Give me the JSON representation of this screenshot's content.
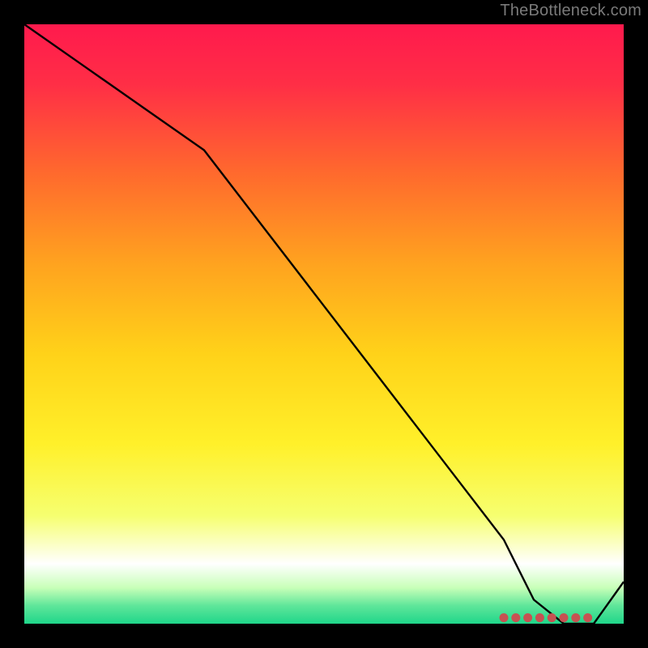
{
  "watermark": "TheBottleneck.com",
  "chart_data": {
    "type": "line",
    "title": "",
    "xlabel": "",
    "ylabel": "",
    "xlim": [
      0,
      100
    ],
    "ylim": [
      0,
      100
    ],
    "x": [
      0,
      10,
      20,
      30,
      40,
      50,
      60,
      70,
      80,
      85,
      90,
      95,
      100
    ],
    "values": [
      100,
      93,
      86,
      79,
      66,
      53,
      40,
      27,
      14,
      4,
      0,
      0,
      7
    ],
    "markers": {
      "x": [
        80,
        82,
        84,
        86,
        88,
        90,
        92,
        94
      ],
      "values": [
        1,
        1,
        1,
        1,
        1,
        1,
        1,
        1
      ]
    },
    "gradient_stops": [
      {
        "offset": 0.0,
        "color": "#ff1a4d"
      },
      {
        "offset": 0.1,
        "color": "#ff2e46"
      },
      {
        "offset": 0.25,
        "color": "#ff6a2d"
      },
      {
        "offset": 0.4,
        "color": "#ffa31f"
      },
      {
        "offset": 0.55,
        "color": "#ffd219"
      },
      {
        "offset": 0.7,
        "color": "#fff02a"
      },
      {
        "offset": 0.82,
        "color": "#f6ff70"
      },
      {
        "offset": 0.9,
        "color": "#ffffff"
      },
      {
        "offset": 0.94,
        "color": "#c8ffb8"
      },
      {
        "offset": 0.97,
        "color": "#5fe69a"
      },
      {
        "offset": 1.0,
        "color": "#1fd68a"
      }
    ],
    "marker_color": "#c75252",
    "line_color": "#000000"
  }
}
